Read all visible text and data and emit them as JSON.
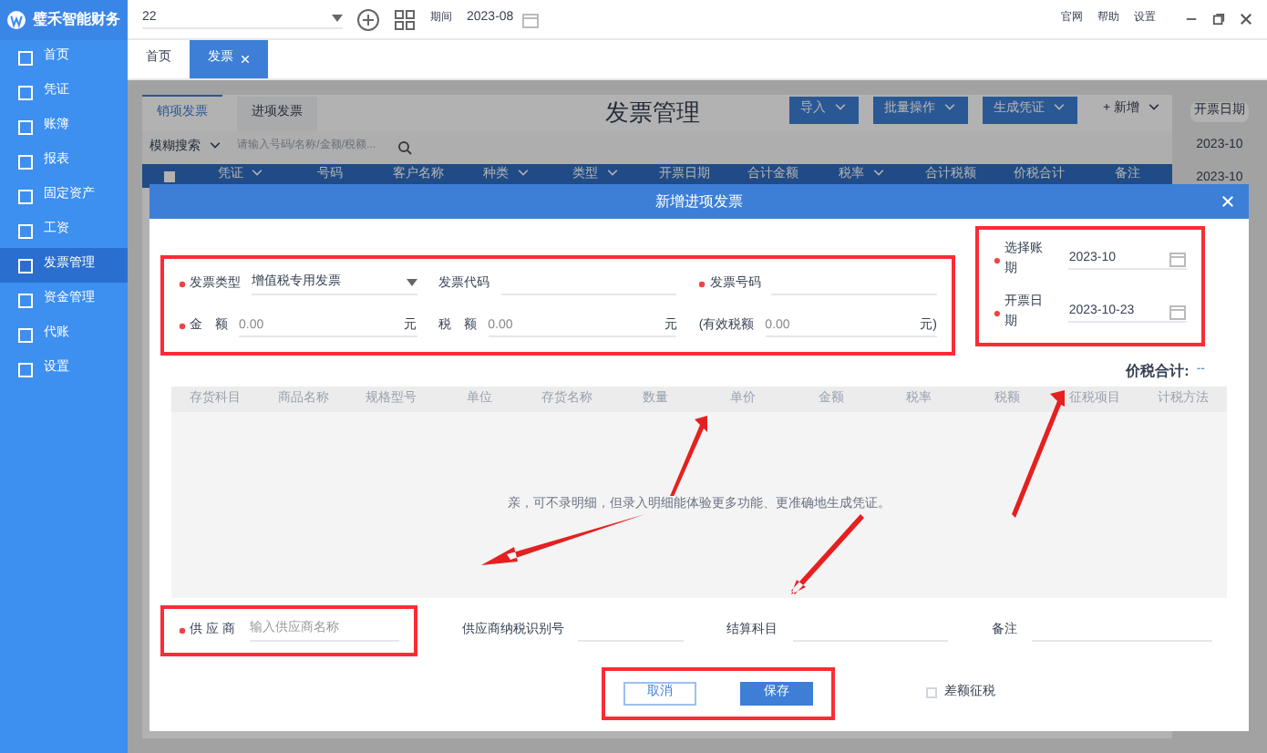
{
  "app": {
    "logo_text": "璧禾智能财务",
    "account": "22",
    "period_label": "期间",
    "period": "2023-08",
    "links": [
      "官网",
      "帮助",
      "设置"
    ]
  },
  "sidebar": {
    "items": [
      {
        "label": "首页",
        "selected": false
      },
      {
        "label": "凭证",
        "selected": false
      },
      {
        "label": "账簿",
        "selected": false
      },
      {
        "label": "报表",
        "selected": false
      },
      {
        "label": "固定资产",
        "selected": false
      },
      {
        "label": "工资",
        "selected": false
      },
      {
        "label": "发票管理",
        "selected": true
      },
      {
        "label": "资金管理",
        "selected": false
      },
      {
        "label": "代账",
        "selected": false
      },
      {
        "label": "设置",
        "selected": false
      }
    ]
  },
  "page_tabs": [
    {
      "label": "首页",
      "selected": false,
      "closable": false
    },
    {
      "label": "发票",
      "selected": true,
      "closable": true
    }
  ],
  "page": {
    "title": "发票管理",
    "tabs": [
      {
        "label": "销项发票",
        "selected": true
      },
      {
        "label": "进项发票",
        "selected": false
      }
    ],
    "select_all_checked": false,
    "search_mode": "模糊搜索",
    "search_placeholder": "请输入号码/名称/金额/税额...",
    "toolbar": [
      {
        "label": "导入",
        "kind": "primary"
      },
      {
        "label": "批量操作",
        "kind": "primary"
      },
      {
        "label": "生成凭证",
        "kind": "primary"
      },
      {
        "label": "+ 新增",
        "kind": "plain"
      }
    ],
    "columns": [
      {
        "label": "凭证",
        "sortable": true
      },
      {
        "label": "号码",
        "sortable": false
      },
      {
        "label": "客户名称",
        "sortable": false
      },
      {
        "label": "种类",
        "sortable": true
      },
      {
        "label": "类型",
        "sortable": true
      },
      {
        "label": "开票日期",
        "sortable": false
      },
      {
        "label": "合计金额",
        "sortable": false
      },
      {
        "label": "税率",
        "sortable": true
      },
      {
        "label": "合计税额",
        "sortable": false
      },
      {
        "label": "价税合计",
        "sortable": false
      },
      {
        "label": "备注",
        "sortable": false
      }
    ],
    "side_column": {
      "header": "开票日期",
      "cells": [
        "2023-10",
        "2023-10"
      ]
    }
  },
  "dialog": {
    "title": "新增进项发票",
    "fields": [
      {
        "label": "发票类型",
        "required": true,
        "value": "增值税专用发票",
        "kind": "select"
      },
      {
        "label": "发票代码",
        "required": false,
        "kind": "text"
      },
      {
        "label": "发票号码",
        "required": true,
        "kind": "text"
      },
      {
        "label": "金　额",
        "required": true,
        "placeholder": "0.00",
        "unit": "元",
        "kind": "text"
      },
      {
        "label": "税　额",
        "required": false,
        "placeholder": "0.00",
        "unit": "元",
        "kind": "text"
      },
      {
        "label": "(有效税额",
        "required": false,
        "placeholder": "0.00",
        "unit": "元)",
        "kind": "text"
      }
    ],
    "date_fields": [
      {
        "label": "选择账期",
        "required": true,
        "value": "2023-10"
      },
      {
        "label": "开票日期",
        "required": true,
        "value": "2023-10-23"
      }
    ],
    "total_label": "价税合计:",
    "total_value": "--",
    "detail_columns": [
      "存货科目",
      "商品名称",
      "规格型号",
      "单位",
      "存货名称",
      "数量",
      "单价",
      "金额",
      "税率",
      "税额",
      "征税项目",
      "计税方法"
    ],
    "empty_hint": "亲，可不录明细，但录入明细能体验更多功能、更准确地生成凭证。",
    "bottom_fields": [
      {
        "label": "供 应 商",
        "required": true,
        "placeholder": "输入供应商名称"
      },
      {
        "label": "供应商纳税识别号",
        "required": false
      },
      {
        "label": "结算科目",
        "required": false
      },
      {
        "label": "备注",
        "required": false
      }
    ],
    "buttons": [
      {
        "label": "取消",
        "kind": "secondary"
      },
      {
        "label": "保存",
        "kind": "primary"
      }
    ],
    "checkbox": {
      "label": "差额征税",
      "checked": false
    }
  }
}
